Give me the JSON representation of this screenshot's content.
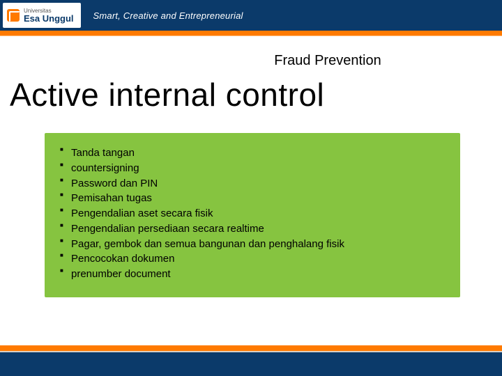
{
  "header": {
    "logo_small": "Universitas",
    "logo_name": "Esa Unggul",
    "tagline": "Smart, Creative and Entrepreneurial"
  },
  "slide": {
    "subtitle": "Fraud Prevention",
    "title": "Active internal control"
  },
  "bullets": [
    "Tanda tangan",
    "countersigning",
    "Password dan PIN",
    "Pemisahan tugas",
    "Pengendalian aset secara fisik",
    "Pengendalian persediaan secara realtime",
    "Pagar, gembok dan semua bangunan dan penghalang fisik",
    "Pencocokan dokumen",
    "prenumber document"
  ]
}
